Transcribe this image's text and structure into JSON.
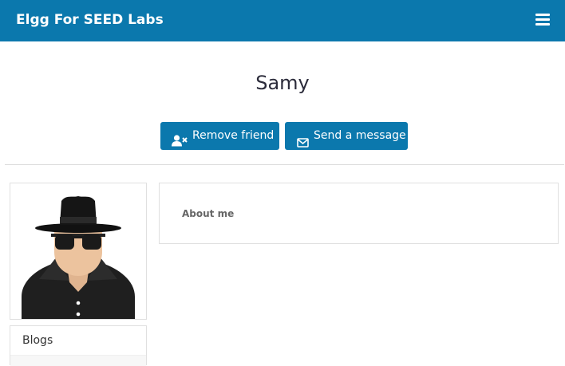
{
  "header": {
    "site_title": "Elgg For SEED Labs",
    "menu_icon": "hamburger-icon",
    "color": "#0b78ad"
  },
  "profile": {
    "name": "Samy",
    "buttons": {
      "remove_friend": "Remove friend",
      "remove_friend_icon": "user-times-icon",
      "send_message": "Send a message",
      "send_message_icon": "envelope-icon"
    },
    "avatar_icon": "spy-avatar",
    "sidebar": {
      "items": [
        {
          "label": "Blogs"
        }
      ]
    },
    "about": {
      "label": "About me"
    }
  }
}
